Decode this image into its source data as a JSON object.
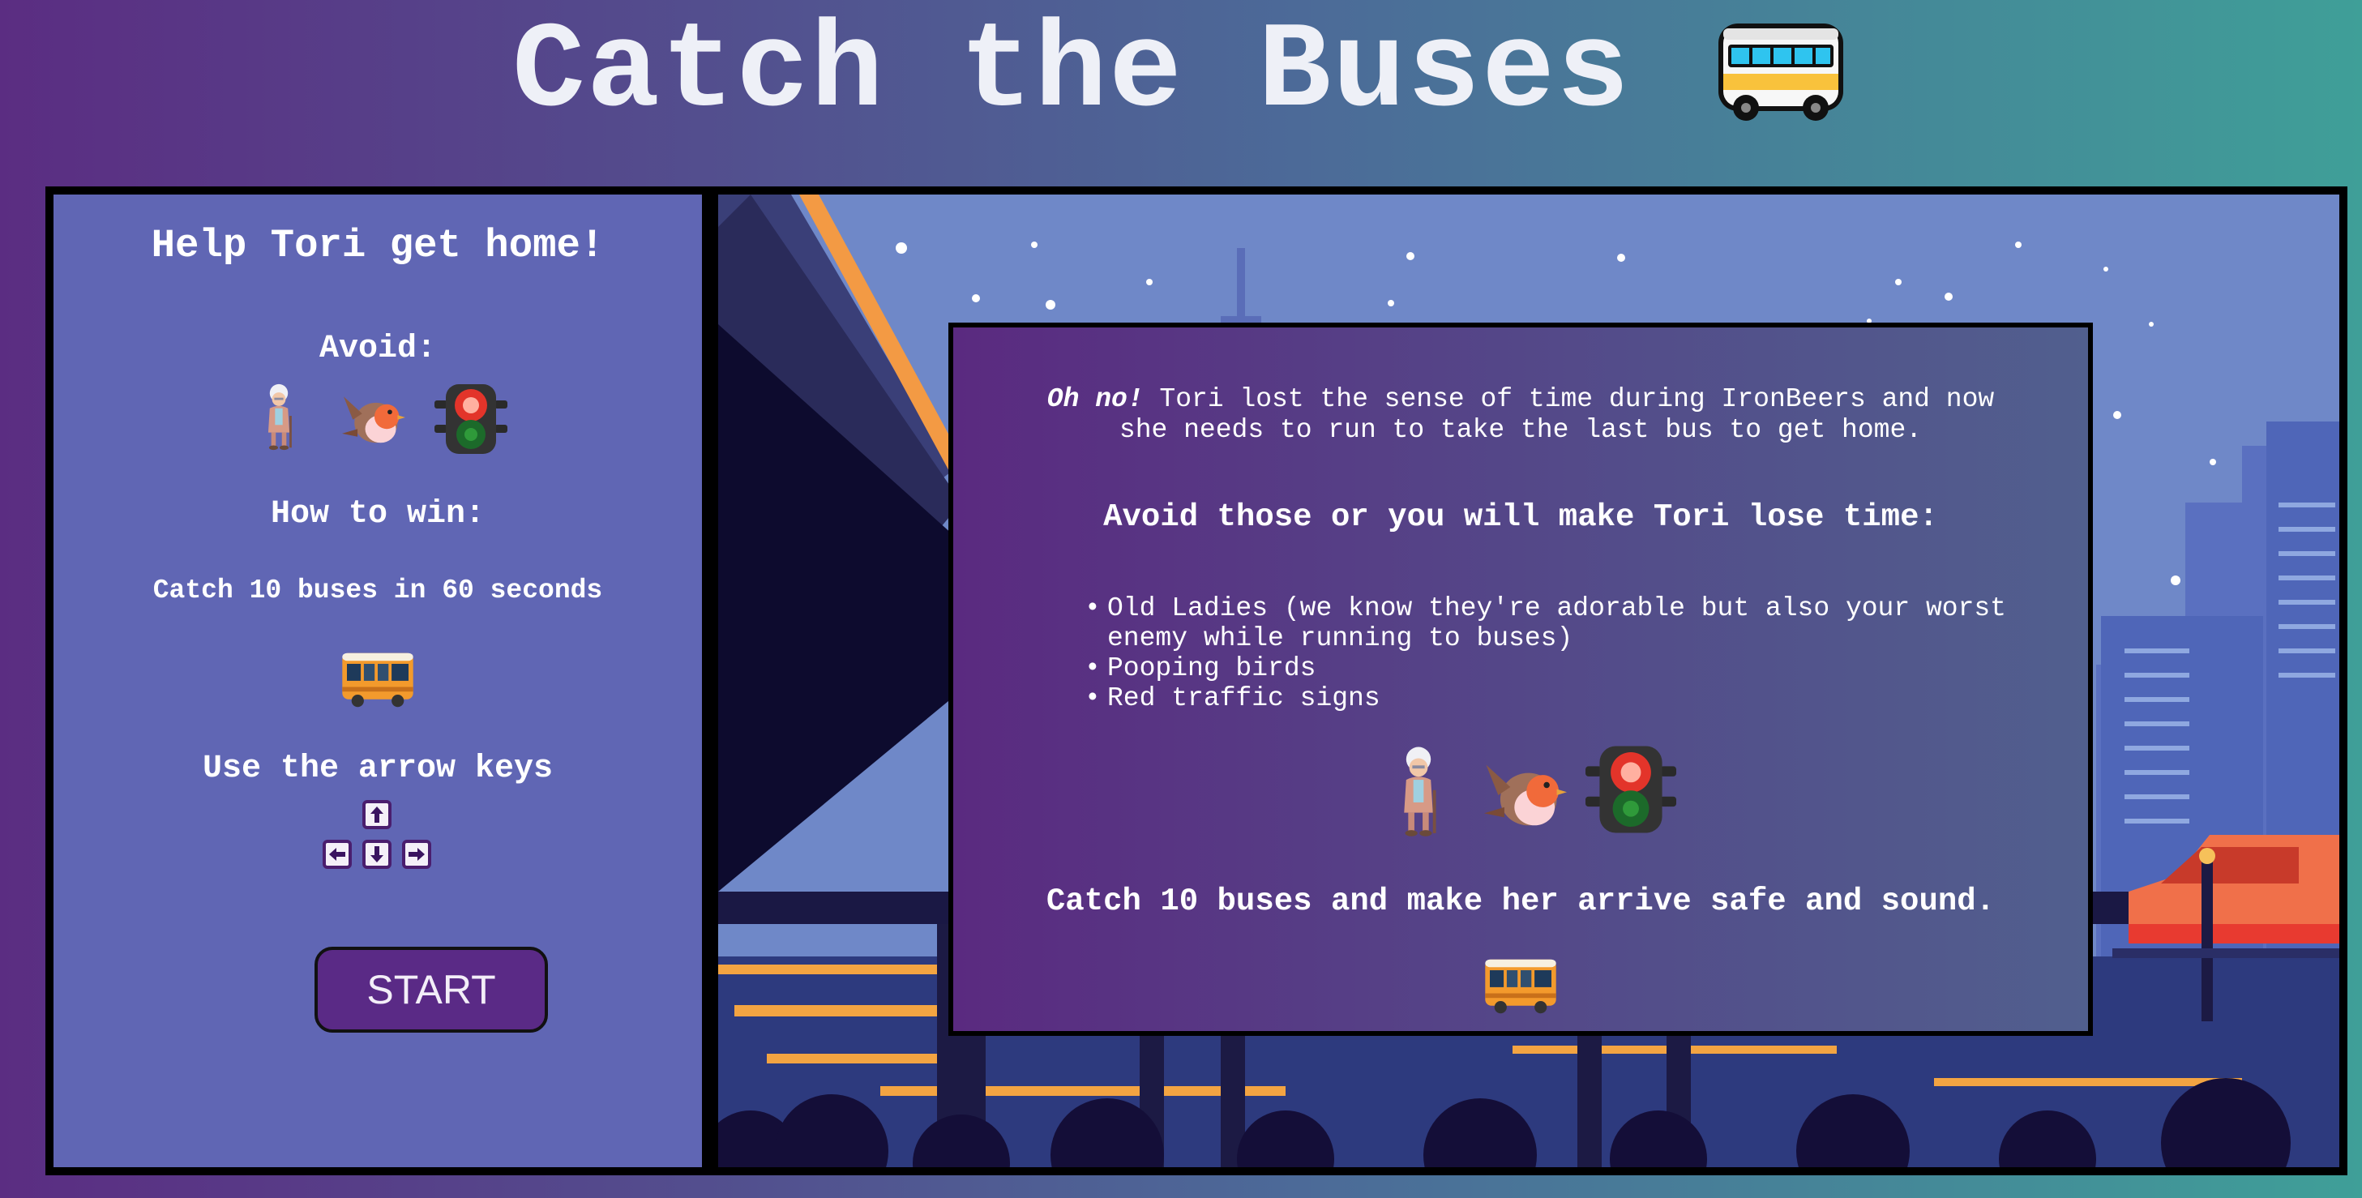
{
  "header": {
    "title": "Catch the Buses"
  },
  "sidebar": {
    "heading": "Help Tori get home!",
    "avoid_label": "Avoid:",
    "win_label": "How to win:",
    "win_text": "Catch 10 buses in 60 seconds",
    "controls_label": "Use the arrow keys",
    "start_label": "START",
    "avoid_icons": [
      "old-lady-icon",
      "bird-icon",
      "traffic-light-icon"
    ]
  },
  "dialog": {
    "intro_emphasis": "Oh no!",
    "intro_line1": " Tori lost the sense of time during IronBeers and now",
    "intro_line2": "she needs to run to take the last bus to get home.",
    "avoid_heading": "Avoid those or you will make Tori lose time:",
    "hazards": [
      "Old Ladies (we know they're adorable but also your worst enemy while running to buses)",
      "Pooping birds",
      "Red traffic signs"
    ],
    "goal_text": "Catch 10 buses and make her arrive safe and sound."
  },
  "colors": {
    "sidebar_bg": "#6066b4",
    "night_sky": "#6f88c8",
    "dialog_bg": "#5a2a80",
    "button_bg": "#5a2a86",
    "bus_orange": "#f39a2c"
  }
}
